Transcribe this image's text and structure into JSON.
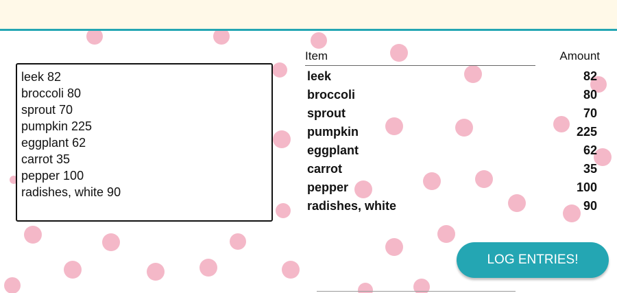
{
  "colors": {
    "banner_background": "#fff9e8",
    "accent": "#24a6b3",
    "dot_color": "#f4b8c8"
  },
  "entries_input": {
    "value": "leek 82\nbroccoli 80\nsprout 70\npumpkin 225\neggplant 62\ncarrot 35\npepper 100\nradishes, white 90"
  },
  "table": {
    "headers": {
      "item": "Item",
      "amount": "Amount"
    },
    "rows": [
      {
        "item": "leek",
        "amount": "82"
      },
      {
        "item": "broccoli",
        "amount": "80"
      },
      {
        "item": "sprout",
        "amount": "70"
      },
      {
        "item": "pumpkin",
        "amount": "225"
      },
      {
        "item": "eggplant",
        "amount": "62"
      },
      {
        "item": "carrot",
        "amount": "35"
      },
      {
        "item": "pepper",
        "amount": "100"
      },
      {
        "item": "radishes, white",
        "amount": "90"
      }
    ]
  },
  "actions": {
    "log_entries_label": "LOG ENTRIES!"
  }
}
